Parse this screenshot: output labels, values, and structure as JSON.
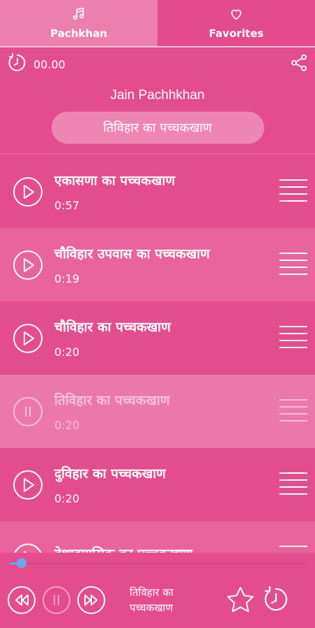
{
  "tabs": [
    {
      "label": "Pachkhan",
      "icon": "music-note-icon",
      "active": true
    },
    {
      "label": "Favorites",
      "icon": "heart-icon",
      "active": false
    }
  ],
  "timer": {
    "value": "00.00",
    "icon": "timer-icon"
  },
  "share_icon": "share-icon",
  "header": {
    "title": "Jain Pachhkhan",
    "current": "तिविहार का पच्चकखाण"
  },
  "list": [
    {
      "title": "एकासणा का पच्चकखाण",
      "duration": "0:57",
      "state": "idle"
    },
    {
      "title": "चौविहार उपवास का पच्चकखाण",
      "duration": "0:19",
      "state": "idle"
    },
    {
      "title": "चौविहार का पच्चकखाण",
      "duration": "0:20",
      "state": "idle"
    },
    {
      "title": "तिविहार का पच्चकखाण",
      "duration": "0:20",
      "state": "playing"
    },
    {
      "title": "दुविहार का पच्चकखाण",
      "duration": "0:20",
      "state": "idle"
    },
    {
      "title": "देशावगासिक का पच्चकखाण",
      "duration": "",
      "state": "idle"
    }
  ],
  "player": {
    "title": "तिविहार का पच्चकखाण",
    "progress": 0.04
  },
  "colors": {
    "background": "#e34d8e",
    "row_alt": "#e9639c",
    "accent_seek": "#6aa7e6"
  }
}
